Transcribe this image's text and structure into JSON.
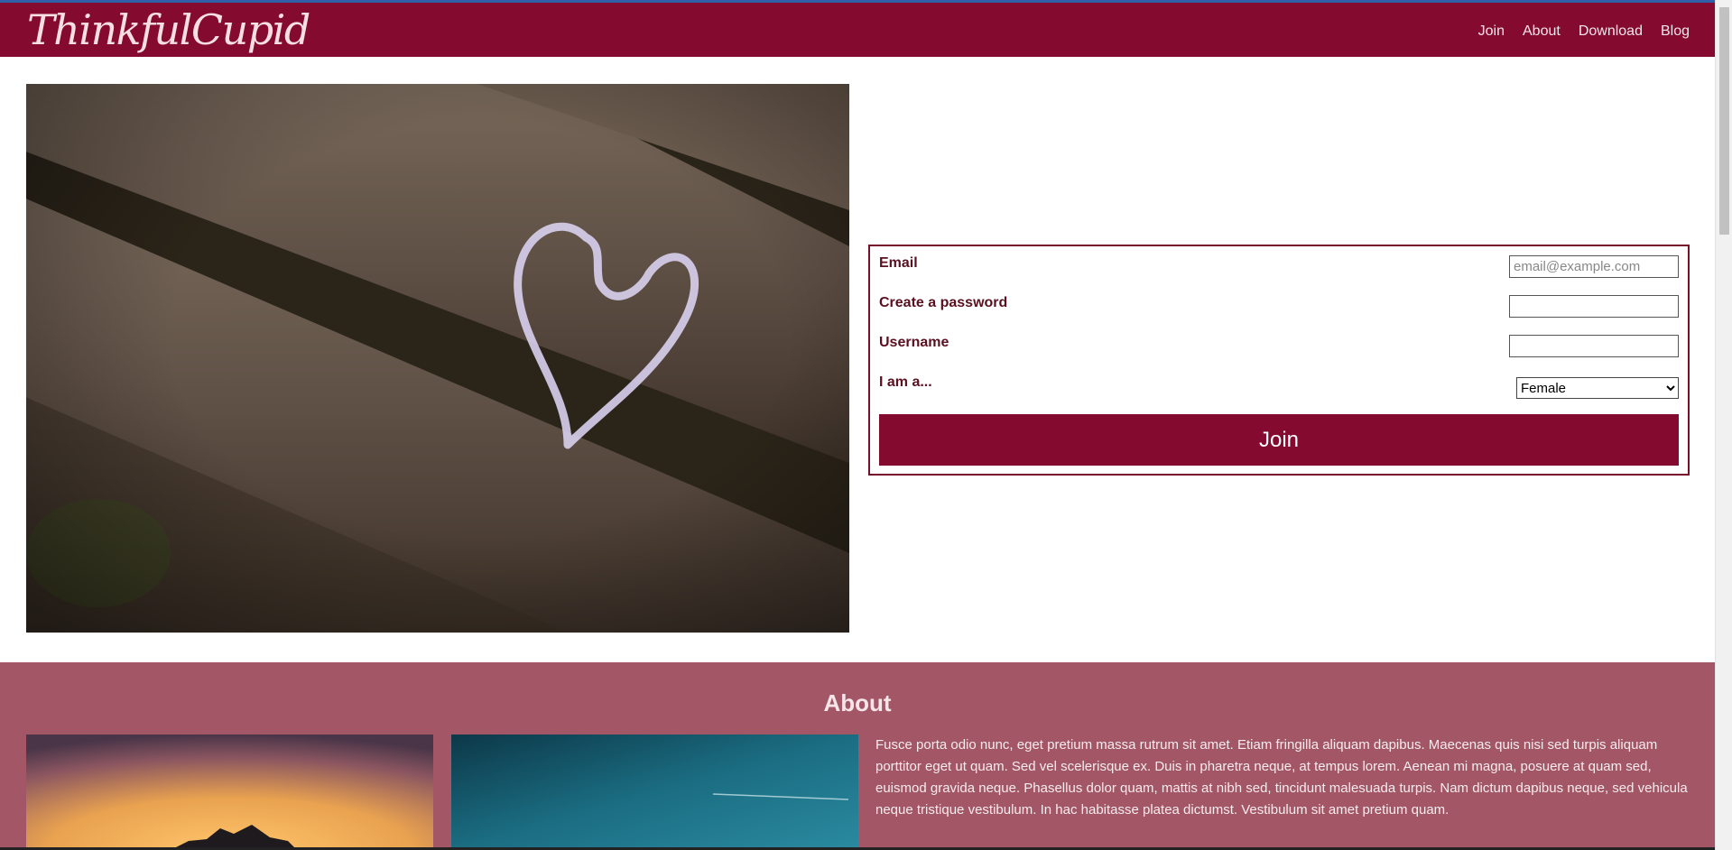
{
  "navbar": {
    "brand": "ThinkfulCupid",
    "links": [
      "Join",
      "About",
      "Download",
      "Blog"
    ]
  },
  "form": {
    "email_label": "Email",
    "email_placeholder": "email@example.com",
    "password_label": "Create a password",
    "username_label": "Username",
    "gender_label": "I am a...",
    "gender_selected": "Female",
    "join_label": "Join"
  },
  "about": {
    "title": "About",
    "text": "Fusce porta odio nunc, eget pretium massa rutrum sit amet. Etiam fringilla aliquam dapibus. Maecenas quis nisi sed turpis aliquam porttitor eget ut quam. Sed vel scelerisque ex. Duis in pharetra neque, at tempus lorem. Aenean mi magna, posuere at quam sed, euismod gravida neque. Phasellus dolor quam, mattis at nibh sed, tincidunt malesuada turpis. Nam dictum dapibus neque, sed vehicula neque tristique vestibulum. In hac habitasse platea dictumst. Vestibulum sit amet pretium quam."
  },
  "colors": {
    "primary": "#850a2f",
    "about_bg": "#a25666"
  }
}
